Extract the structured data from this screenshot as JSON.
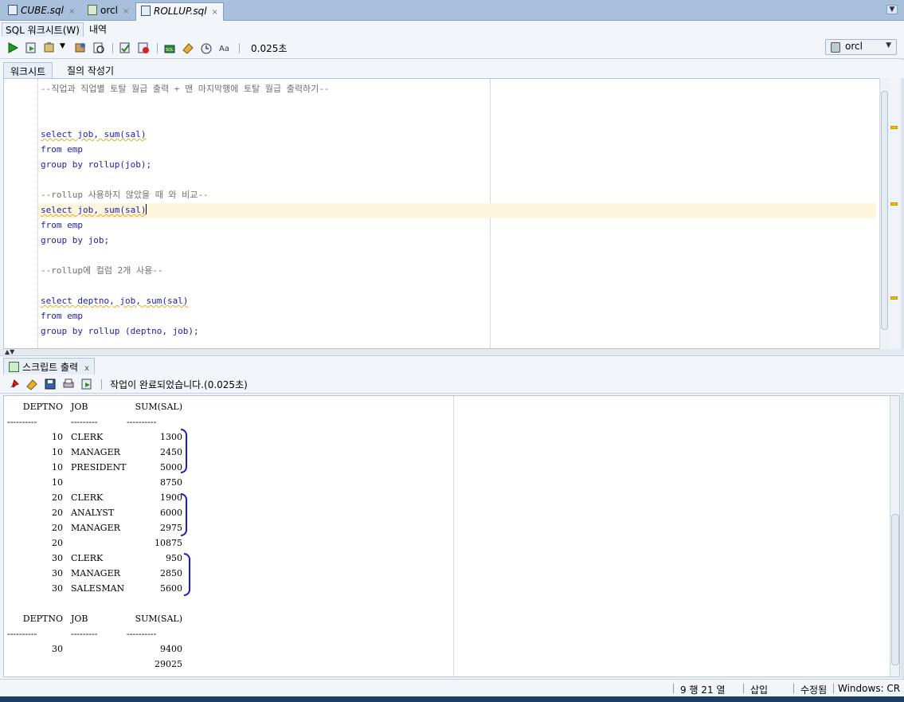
{
  "file_tabs": [
    {
      "label": "CUBE.sql",
      "close": "×"
    },
    {
      "label": "orcl",
      "close": "×"
    },
    {
      "label": "ROLLUP.sql",
      "close": "×"
    }
  ],
  "sub_tabs": [
    "SQL 워크시트(W)",
    "내역"
  ],
  "toolbar": {
    "elapsed": "0.025초",
    "connection": "orcl"
  },
  "worksheet_tabs": [
    "워크시트",
    "질의 작성기"
  ],
  "editor": {
    "comment1": "--직업과 직업별 토탈 월급 출력 + 맨 마지막행에 토탈 월급 출력하기--",
    "comment2": "--rollup 사용하지 않았을 때 와 비교--",
    "comment3": "--rollup에 컬럼 2개 사용--",
    "q1_select": "select job, sum(sal)",
    "q1_from": "from emp",
    "q1_group": "group by rollup(job);",
    "q2_select": "select job, sum(sal)",
    "q2_from": "from emp",
    "q2_group": "group by job;",
    "q3_select": "select deptno, job, sum(sal)",
    "q3_from": "from emp",
    "q3_group": "group by rollup (deptno, job);"
  },
  "output_panel": {
    "tab_label": "스크립트 출력",
    "tab_close": "x",
    "status": "작업이 완료되었습니다.(0.025초)"
  },
  "output": {
    "header": [
      "DEPTNO",
      "JOB",
      "SUM(SAL)"
    ],
    "separator": [
      "----------",
      "---------",
      "----------"
    ],
    "rows": [
      [
        "10",
        "CLERK",
        "1300"
      ],
      [
        "10",
        "MANAGER",
        "2450"
      ],
      [
        "10",
        "PRESIDENT",
        "5000"
      ],
      [
        "10",
        "",
        "8750"
      ],
      [
        "20",
        "CLERK",
        "1900"
      ],
      [
        "20",
        "ANALYST",
        "6000"
      ],
      [
        "20",
        "MANAGER",
        "2975"
      ],
      [
        "20",
        "",
        "10875"
      ],
      [
        "30",
        "CLERK",
        "950"
      ],
      [
        "30",
        "MANAGER",
        "2850"
      ],
      [
        "30",
        "SALESMAN",
        "5600"
      ]
    ],
    "rows2": [
      [
        "30",
        "",
        "9400"
      ],
      [
        "",
        "",
        "29025"
      ]
    ]
  },
  "statusbar": {
    "position": "9 행 21 열",
    "mode": "삽입",
    "modified": "수정됨",
    "eol": "Windows: CR"
  }
}
